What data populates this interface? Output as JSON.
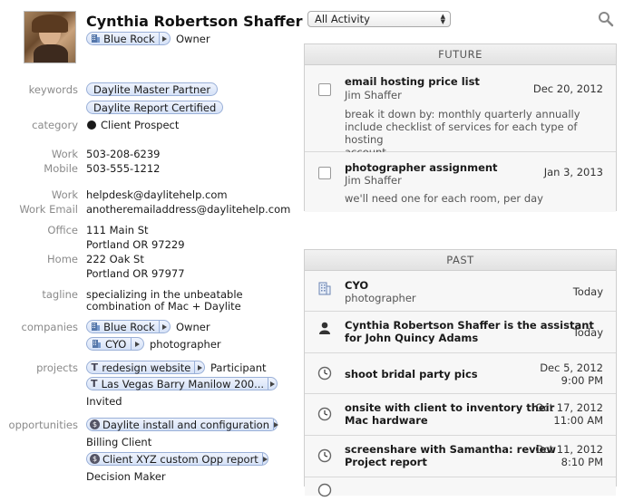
{
  "contact": {
    "name": "Cynthia Robertson Shaffer",
    "primary_company": "Blue Rock",
    "primary_role": "Owner"
  },
  "fields": {
    "keywords_label": "keywords",
    "keywords": [
      "Daylite Master Partner",
      "Daylite Report Certified"
    ],
    "category_label": "category",
    "category_value": "Client Prospect",
    "category_color": "#1a1a1a",
    "phones": [
      {
        "label": "Work",
        "value": "503-208-6239"
      },
      {
        "label": "Mobile",
        "value": "503-555-1212"
      }
    ],
    "emails": [
      {
        "label": "Work",
        "value": "helpdesk@daylitehelp.com"
      },
      {
        "label": "Work Email",
        "value": "anotheremailaddress@daylitehelp.com"
      }
    ],
    "addresses": [
      {
        "label": "Office",
        "line1": "111 Main St",
        "line2": "Portland OR 97229"
      },
      {
        "label": "Home",
        "line1": "222 Oak St",
        "line2": "Portland OR 97977"
      }
    ],
    "tagline_label": "tagline",
    "tagline_line1": "specializing in the unbeatable",
    "tagline_line2": "combination of Mac + Daylite",
    "companies_label": "companies",
    "companies": [
      {
        "name": "Blue Rock",
        "role": "Owner",
        "icon": "building-icon"
      },
      {
        "name": "CYO",
        "role": "photographer",
        "icon": "building-icon"
      }
    ],
    "projects_label": "projects",
    "projects": [
      {
        "name": "redesign website",
        "role": "Participant",
        "icon": "project-icon"
      },
      {
        "name": "Las Vegas Barry Manilow 200...",
        "role": "Invited",
        "icon": "project-icon"
      }
    ],
    "opportunities_label": "opportunities",
    "opportunities": [
      {
        "name": "Daylite install and configuration",
        "role": "Billing Client",
        "icon": "dollar-icon"
      },
      {
        "name": "Client XYZ custom Opp report",
        "role": "Decision Maker",
        "icon": "dollar-icon"
      }
    ]
  },
  "activity": {
    "filter_value": "All Activity",
    "future_header": "FUTURE",
    "future": [
      {
        "title": "email hosting price list",
        "person": "Jim Shaffer",
        "date": "Dec 20, 2012",
        "note_lines": [
          "break it down by:  monthly  quarterly  annually",
          "include checklist of services for each type of hosting",
          "account"
        ]
      },
      {
        "title": "photographer assignment",
        "person": "Jim Shaffer",
        "date": "Jan 3, 2013",
        "note_lines": [
          "we'll need one for each room, per day"
        ]
      }
    ],
    "past_header": "PAST",
    "past": [
      {
        "icon": "building-icon",
        "title": "CYO",
        "sub": "photographer",
        "date": "Today",
        "time": ""
      },
      {
        "icon": "person-icon",
        "title": "Cynthia Robertson Shaffer is the assistant",
        "title2": "for John Quincy Adams",
        "date": "Today",
        "time": ""
      },
      {
        "icon": "clock-icon",
        "title": "shoot bridal party pics",
        "date": "Dec 5, 2012",
        "time": "9:00 PM"
      },
      {
        "icon": "clock-icon",
        "title": "onsite with client to inventory their",
        "title2": "Mac hardware",
        "date": "Oct 17, 2012",
        "time": "11:00 AM"
      },
      {
        "icon": "clock-icon",
        "title": "screenshare with Samantha: review",
        "title2": "Project report",
        "date": "Oct 11, 2012",
        "time": "8:10 PM"
      }
    ]
  }
}
